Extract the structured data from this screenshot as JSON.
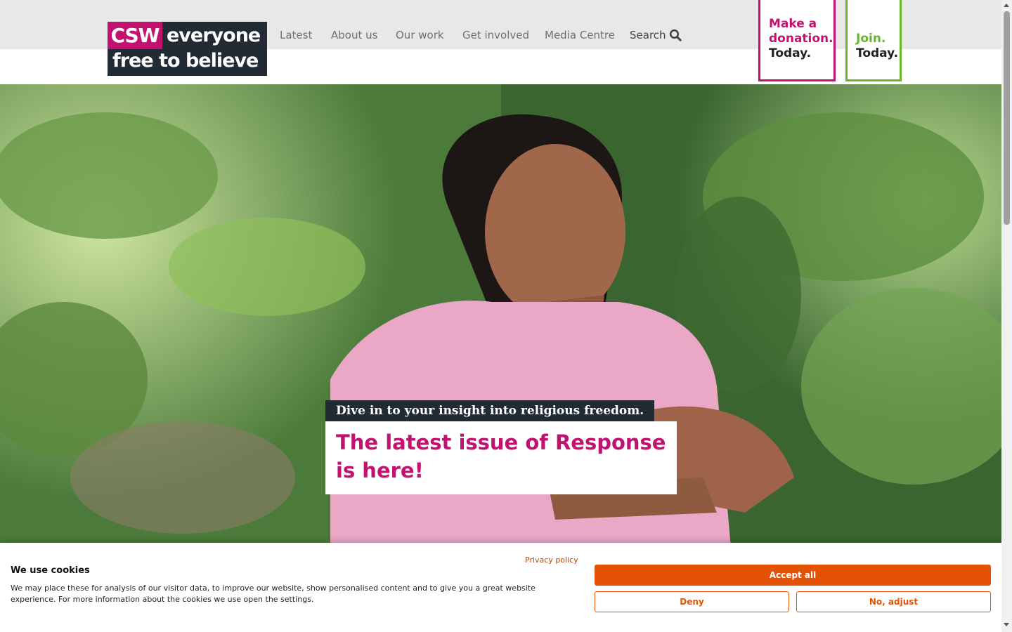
{
  "header": {
    "logo": {
      "badge": "CSW",
      "line1": "everyone",
      "line2": "free to believe"
    },
    "nav": [
      "Latest",
      "About us",
      "Our work",
      "Get involved",
      "Media Centre"
    ],
    "search_label": "Search",
    "donate": {
      "line1": "Make a",
      "line2": "donation.",
      "line3": "Today."
    },
    "join": {
      "line1": "Join.",
      "line2": "Today."
    }
  },
  "hero": {
    "kicker": "Dive in to your insight into religious freedom.",
    "headline": "The latest issue of Response is here!"
  },
  "cookie_banner": {
    "title": "We use cookies",
    "text": "We may place these for analysis of our visitor data, to improve our website, show personalised content and to give you a great website experience. For more information about the cookies we use open the settings.",
    "privacy_link": "Privacy policy",
    "accept_label": "Accept all",
    "deny_label": "Deny",
    "adjust_label": "No, adjust"
  },
  "colors": {
    "brand_magenta": "#c0126e",
    "brand_green": "#6ab42d",
    "cookie_orange": "#e45205",
    "logo_dark": "#222a33"
  }
}
